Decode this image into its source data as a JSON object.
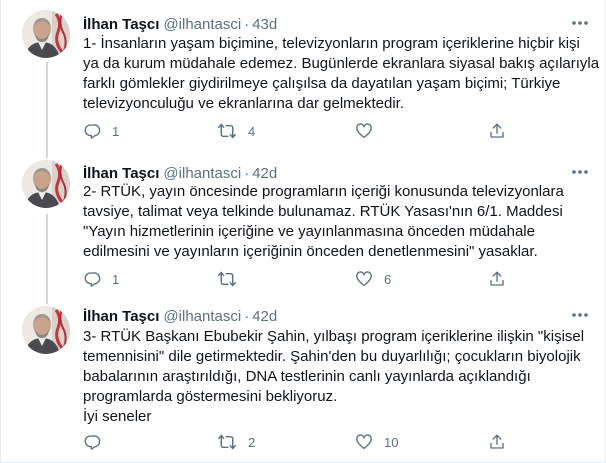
{
  "tweets": [
    {
      "name": "İlhan Taşcı",
      "handle": "@ilhantasci",
      "separator": "·",
      "time": "43d",
      "lines": [
        "1- İnsanların yaşam biçimine, televizyonların program içeriklerine hiçbir kişi",
        "ya da kurum müdahale edemez. Bugünlerde ekranlara siyasal bakış açılarıyla",
        "farklı gömlekler giydirilmeye çalışılsa da dayatılan yaşam biçimi; Türkiye",
        "televizyonculuğu ve ekranlarına dar gelmektedir."
      ],
      "replies": "1",
      "retweets": "4",
      "likes": "",
      "share": ""
    },
    {
      "name": "İlhan Taşcı",
      "handle": "@ilhantasci",
      "separator": "·",
      "time": "42d",
      "lines": [
        "2- RTÜK, yayın öncesinde programların içeriği konusunda televizyonlara",
        "tavsiye, talimat veya telkinde bulunamaz. RTÜK Yasası'nın 6/1. Maddesi",
        "\"Yayın hizmetlerinin içeriğine ve yayınlanmasına önceden müdahale",
        "edilmesini ve yayınların içeriğinin önceden denetlenmesini\" yasaklar."
      ],
      "replies": "1",
      "retweets": "",
      "likes": "6",
      "share": ""
    },
    {
      "name": "İlhan Taşcı",
      "handle": "@ilhantasci",
      "separator": "·",
      "time": "42d",
      "lines": [
        "3- RTÜK Başkanı Ebubekir Şahin, yılbaşı program içeriklerine ilişkin \"kişisel",
        "temennisini\" dile getirmektedir. Şahin'den bu duyarlılığı; çocukların biyolojik",
        "babalarının araştırıldığı, DNA testlerinin canlı yayınlarda açıklandığı",
        "programlarda göstermesini bekliyoruz.",
        "İyi seneler"
      ],
      "replies": "",
      "retweets": "2",
      "likes": "10",
      "share": ""
    }
  ],
  "icons": {
    "more": "more-horizontal-icon",
    "reply": "reply-icon",
    "retweet": "retweet-icon",
    "like": "heart-icon",
    "share": "share-icon"
  },
  "colors": {
    "text": "#0f1419",
    "secondary": "#5b7083",
    "divider": "#e6ecf0",
    "thread_line": "#cfd9de"
  }
}
